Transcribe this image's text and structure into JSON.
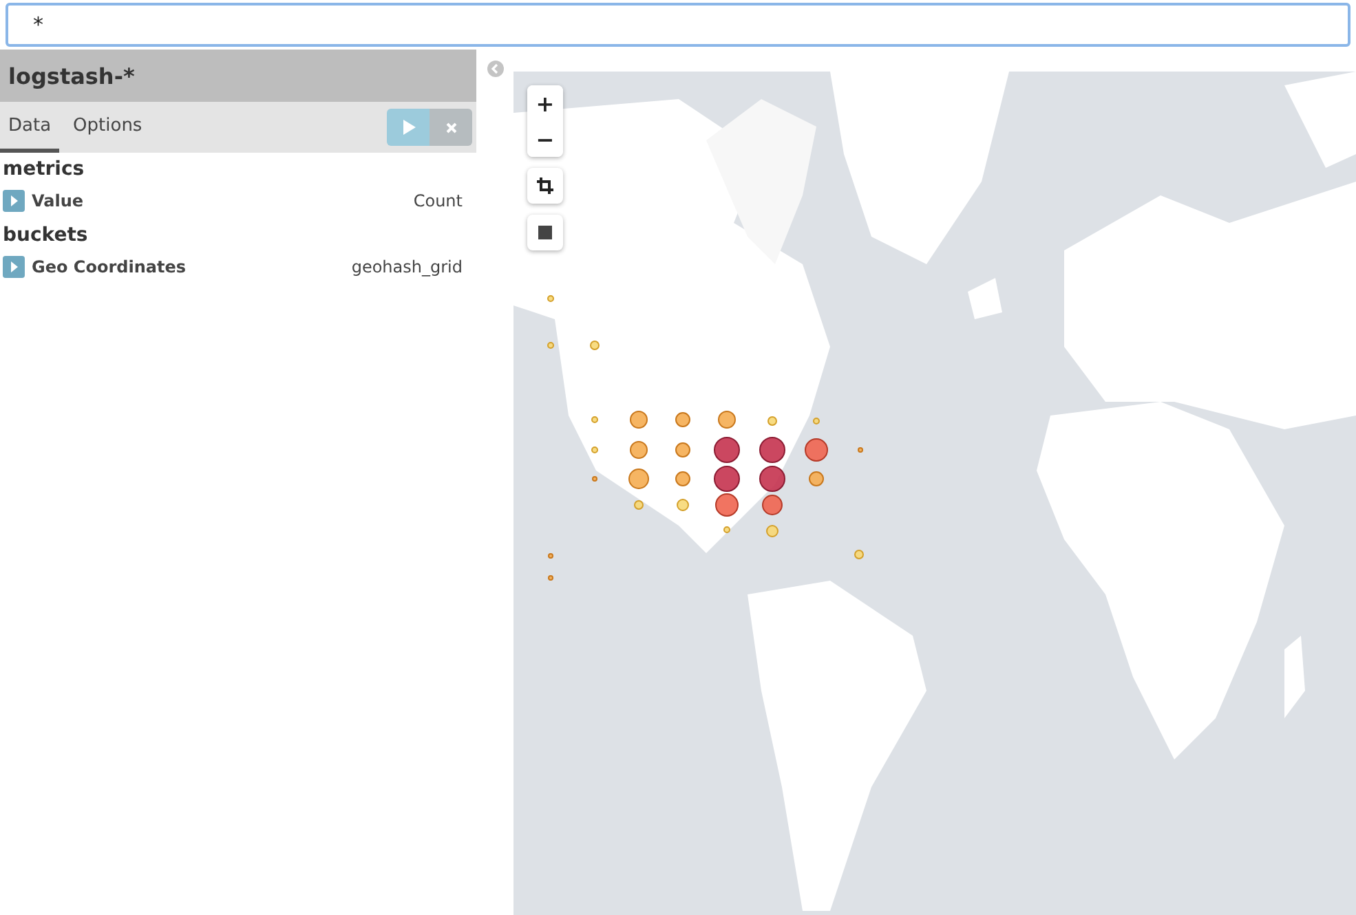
{
  "search": {
    "value": "*"
  },
  "panel": {
    "title": "logstash-*"
  },
  "tabs": [
    {
      "label": "Data",
      "selected": true
    },
    {
      "label": "Options",
      "selected": false
    }
  ],
  "sections": [
    {
      "title": "metrics",
      "items": [
        {
          "label": "Value",
          "type": "Count"
        }
      ]
    },
    {
      "title": "buckets",
      "items": [
        {
          "label": "Geo Coordinates",
          "type": "geohash_grid"
        }
      ]
    }
  ],
  "map": {
    "zoom_in": "+",
    "zoom_out": "−"
  }
}
